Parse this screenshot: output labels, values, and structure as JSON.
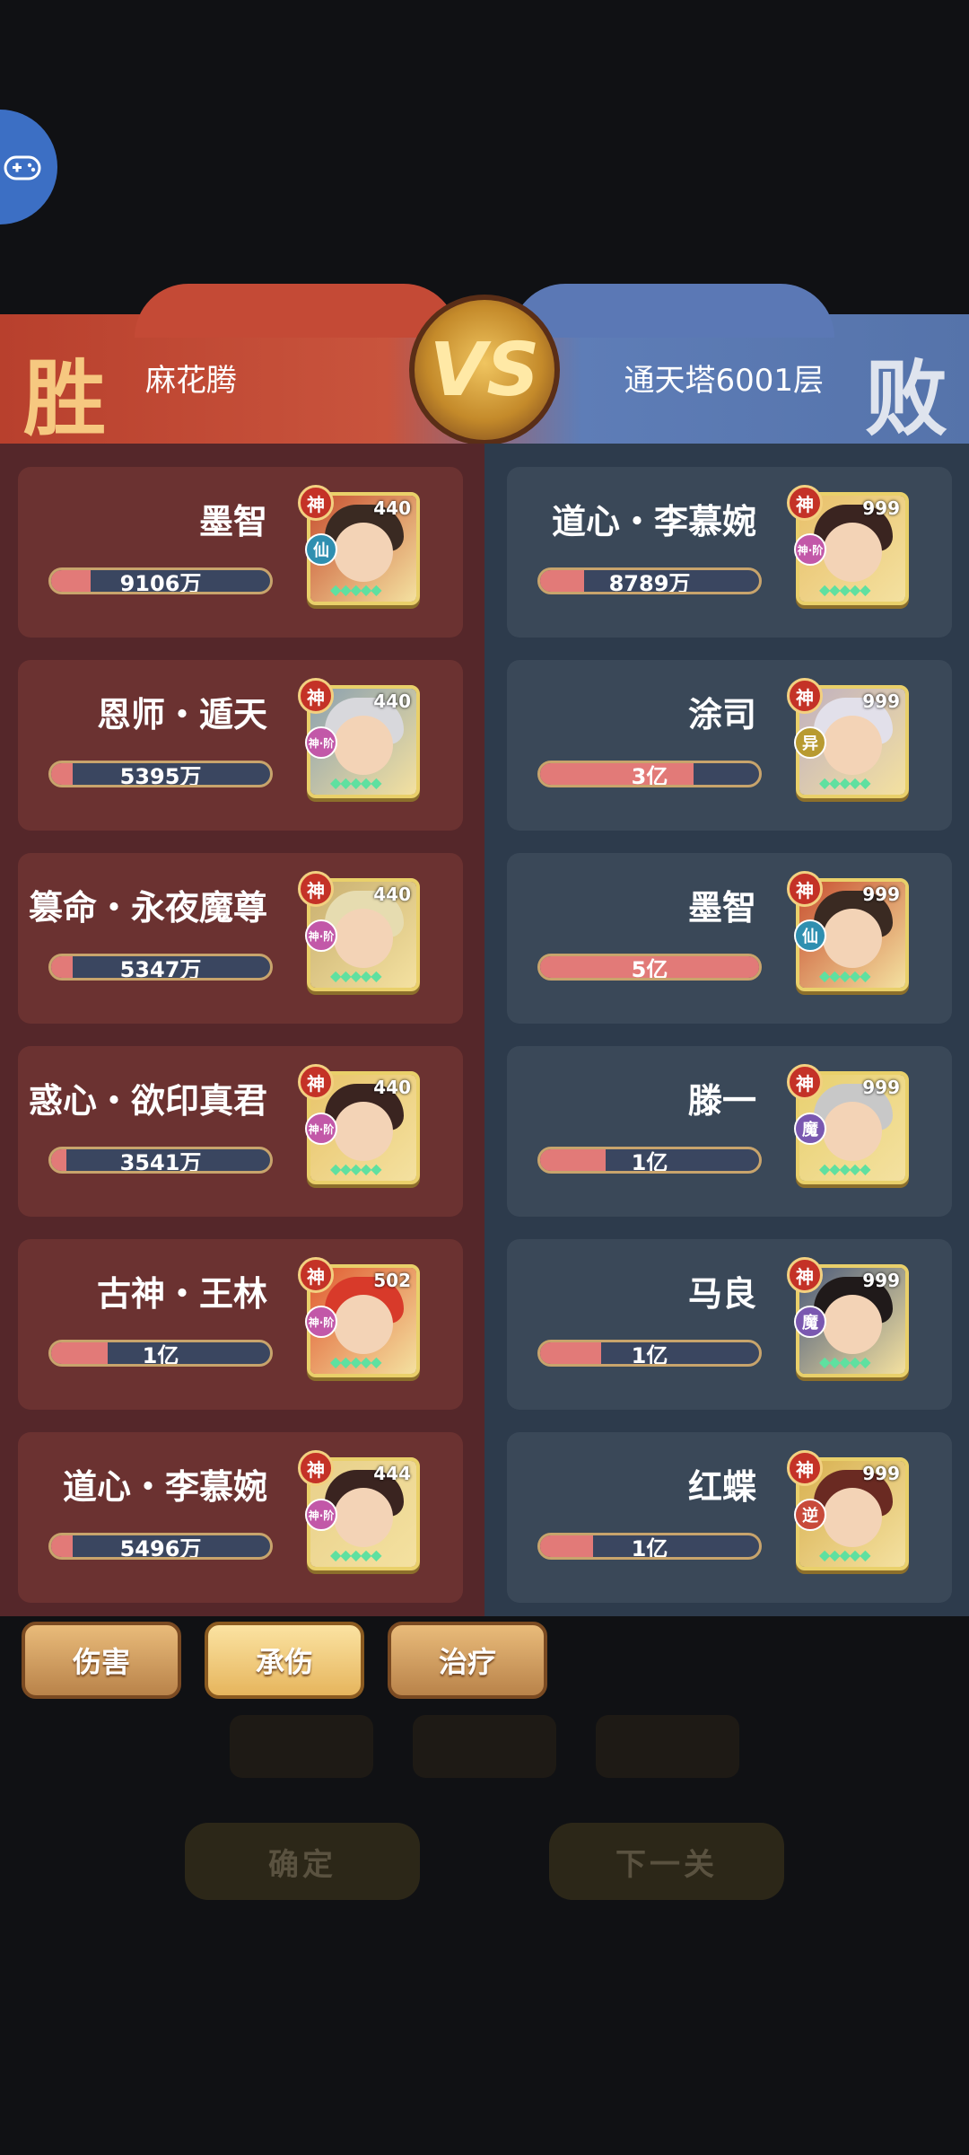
{
  "header": {
    "win_label": "胜",
    "lose_label": "败",
    "vs_label": "VS",
    "player_name": "麻花腾",
    "enemy_name": "通天塔6001层"
  },
  "allies": [
    {
      "name": "墨智",
      "damage_text": "9106万",
      "fill": 0.18,
      "level": "440",
      "race": "仙",
      "race_color": "#2f8fb0",
      "hair_color": "#3a2a22",
      "bg_color": "#c85030"
    },
    {
      "name": "恩师・遁天",
      "damage_text": "5395万",
      "fill": 0.1,
      "level": "440",
      "race": "神·阶",
      "race_color": "#c258a8",
      "hair_color": "#d8d8dc",
      "bg_color": "#8aa0b0"
    },
    {
      "name": "篡命・永夜魔尊",
      "damage_text": "5347万",
      "fill": 0.1,
      "level": "440",
      "race": "神·阶",
      "race_color": "#c258a8",
      "hair_color": "#e6dcb0",
      "bg_color": "#c9b070"
    },
    {
      "name": "惑心・欲印真君",
      "damage_text": "3541万",
      "fill": 0.07,
      "level": "440",
      "race": "神·阶",
      "race_color": "#c258a8",
      "hair_color": "#3a2420",
      "bg_color": "#e8c46a"
    },
    {
      "name": "古神・王林",
      "damage_text": "1亿",
      "fill": 0.26,
      "level": "502",
      "race": "神·阶",
      "race_color": "#c258a8",
      "hair_color": "#d83a2a",
      "bg_color": "#e05a30"
    },
    {
      "name": "道心・李慕婉",
      "damage_text": "5496万",
      "fill": 0.1,
      "level": "444",
      "race": "神·阶",
      "race_color": "#c258a8",
      "hair_color": "#3a2420",
      "bg_color": "#e8d08a"
    }
  ],
  "enemies": [
    {
      "name": "道心・李慕婉",
      "damage_text": "8789万",
      "fill": 0.2,
      "level": "999",
      "race": "神·阶",
      "race_color": "#c258a8",
      "hair_color": "#3a2420",
      "bg_color": "#e8c06a"
    },
    {
      "name": "涂司",
      "damage_text": "3亿",
      "fill": 0.7,
      "level": "999",
      "race": "异",
      "race_color": "#b89a30",
      "hair_color": "#e2e0ea",
      "bg_color": "#c0b0c0"
    },
    {
      "name": "墨智",
      "damage_text": "5亿",
      "fill": 1.0,
      "level": "999",
      "race": "仙",
      "race_color": "#2f8fb0",
      "hair_color": "#3a2a22",
      "bg_color": "#c85030"
    },
    {
      "name": "滕一",
      "damage_text": "1亿",
      "fill": 0.3,
      "level": "999",
      "race": "魔",
      "race_color": "#7a58b0",
      "hair_color": "#c8c8c8",
      "bg_color": "#e8d070"
    },
    {
      "name": "马良",
      "damage_text": "1亿",
      "fill": 0.28,
      "level": "999",
      "race": "魔",
      "race_color": "#7a58b0",
      "hair_color": "#201a1a",
      "bg_color": "#4a5a7a"
    },
    {
      "name": "红蝶",
      "damage_text": "1亿",
      "fill": 0.24,
      "level": "999",
      "race": "逆",
      "race_color": "#c84a3a",
      "hair_color": "#6a2a22",
      "bg_color": "#d8b050"
    }
  ],
  "god_tag": "神",
  "tabs": [
    {
      "label": "伤害",
      "active": false
    },
    {
      "label": "承伤",
      "active": true
    },
    {
      "label": "治疗",
      "active": false
    }
  ],
  "background_buttons": {
    "confirm": "确定",
    "next": "下一关"
  }
}
